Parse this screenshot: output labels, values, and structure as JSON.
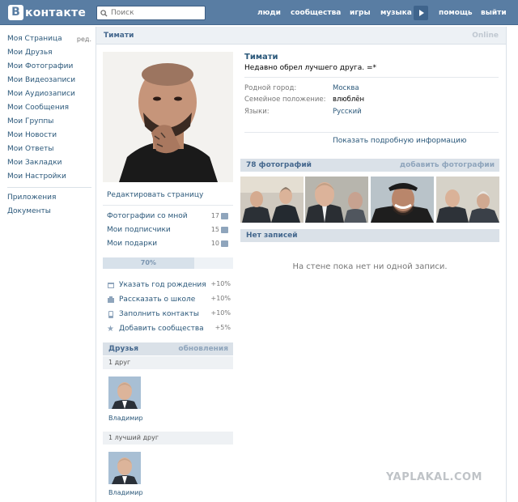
{
  "header": {
    "logo_letter": "В",
    "logo_text": "контакте",
    "search_placeholder": "Поиск",
    "nav": [
      "люди",
      "сообщества",
      "игры",
      "музыка",
      "помощь",
      "выйти"
    ]
  },
  "leftnav": {
    "items": [
      "Моя Страница",
      "Мои Друзья",
      "Мои Фотографии",
      "Мои Видеозаписи",
      "Мои Аудиозаписи",
      "Мои Сообщения",
      "Мои Группы",
      "Мои Новости",
      "Мои Ответы",
      "Мои Закладки",
      "Мои Настройки"
    ],
    "edit_label": "ред.",
    "extra": [
      "Приложения",
      "Документы"
    ]
  },
  "page": {
    "title": "Тимати",
    "online": "Online"
  },
  "profile": {
    "edit_page": "Редактировать страницу",
    "counters": [
      {
        "label": "Фотографии со мной",
        "count": "17"
      },
      {
        "label": "Мои подписчики",
        "count": "15"
      },
      {
        "label": "Мои подарки",
        "count": "10"
      }
    ],
    "progress_text": "70%",
    "progress_value": 70,
    "tips": [
      {
        "label": "Указать год рождения",
        "pct": "+10%"
      },
      {
        "label": "Рассказать о школе",
        "pct": "+10%"
      },
      {
        "label": "Заполнить контакты",
        "pct": "+10%"
      },
      {
        "label": "Добавить сообщества",
        "pct": "+5%"
      }
    ]
  },
  "friends": {
    "title": "Друзья",
    "updates": "обновления",
    "count_label": "1 друг",
    "friend_name": "Владимир",
    "best_label": "1 лучший друг",
    "best_name": "Владимир"
  },
  "info": {
    "name": "Тимати",
    "status": "Недавно обрел лучшего друга. =*",
    "rows": [
      {
        "key": "Родной город:",
        "value": "Москва"
      },
      {
        "key": "Семейное положение:",
        "value": "влюблён"
      },
      {
        "key": "Языки:",
        "value": "Русский"
      }
    ],
    "more": "Показать подробную информацию"
  },
  "photos": {
    "title": "78 фотографий",
    "add": "добавить фотографии"
  },
  "wall": {
    "title": "Нет записей",
    "empty": "На стене пока нет ни одной записи."
  },
  "watermark": "YAPLAKAL.COM",
  "colors": {
    "header_bg": "#597da3",
    "link": "#2b587a",
    "block_head": "#dae1e8"
  }
}
